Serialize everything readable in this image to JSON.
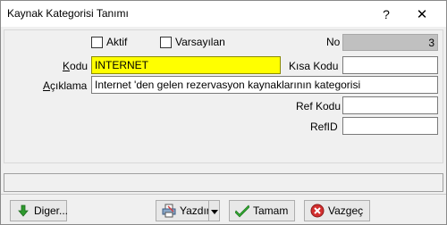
{
  "window": {
    "title": "Kaynak Kategorisi Tanımı",
    "help_symbol": "?",
    "close_symbol": "✕"
  },
  "form": {
    "aktif_label": "Aktif",
    "varsayilan_label": "Varsayılan",
    "no_label": "No",
    "no_value": "3",
    "kodu_label": "Kodu",
    "kodu_value": "INTERNET",
    "kisa_kodu_label": "Kısa Kodu",
    "kisa_kodu_value": "",
    "aciklama_label": "Açıklama",
    "aciklama_value": "Internet 'den gelen rezervasyon kaynaklarının kategorisi",
    "ref_kodu_label": "Ref Kodu",
    "ref_kodu_value": "",
    "ref_id_label": "RefID",
    "ref_id_value": ""
  },
  "buttons": {
    "diger_label": "Diger...",
    "yazdir_label": "Yazdır",
    "tamam_label": "Tamam",
    "vazgec_label": "Vazgeç"
  },
  "colors": {
    "kodu_highlight": "#ffff00",
    "no_field_bg": "#c0c0c0"
  }
}
